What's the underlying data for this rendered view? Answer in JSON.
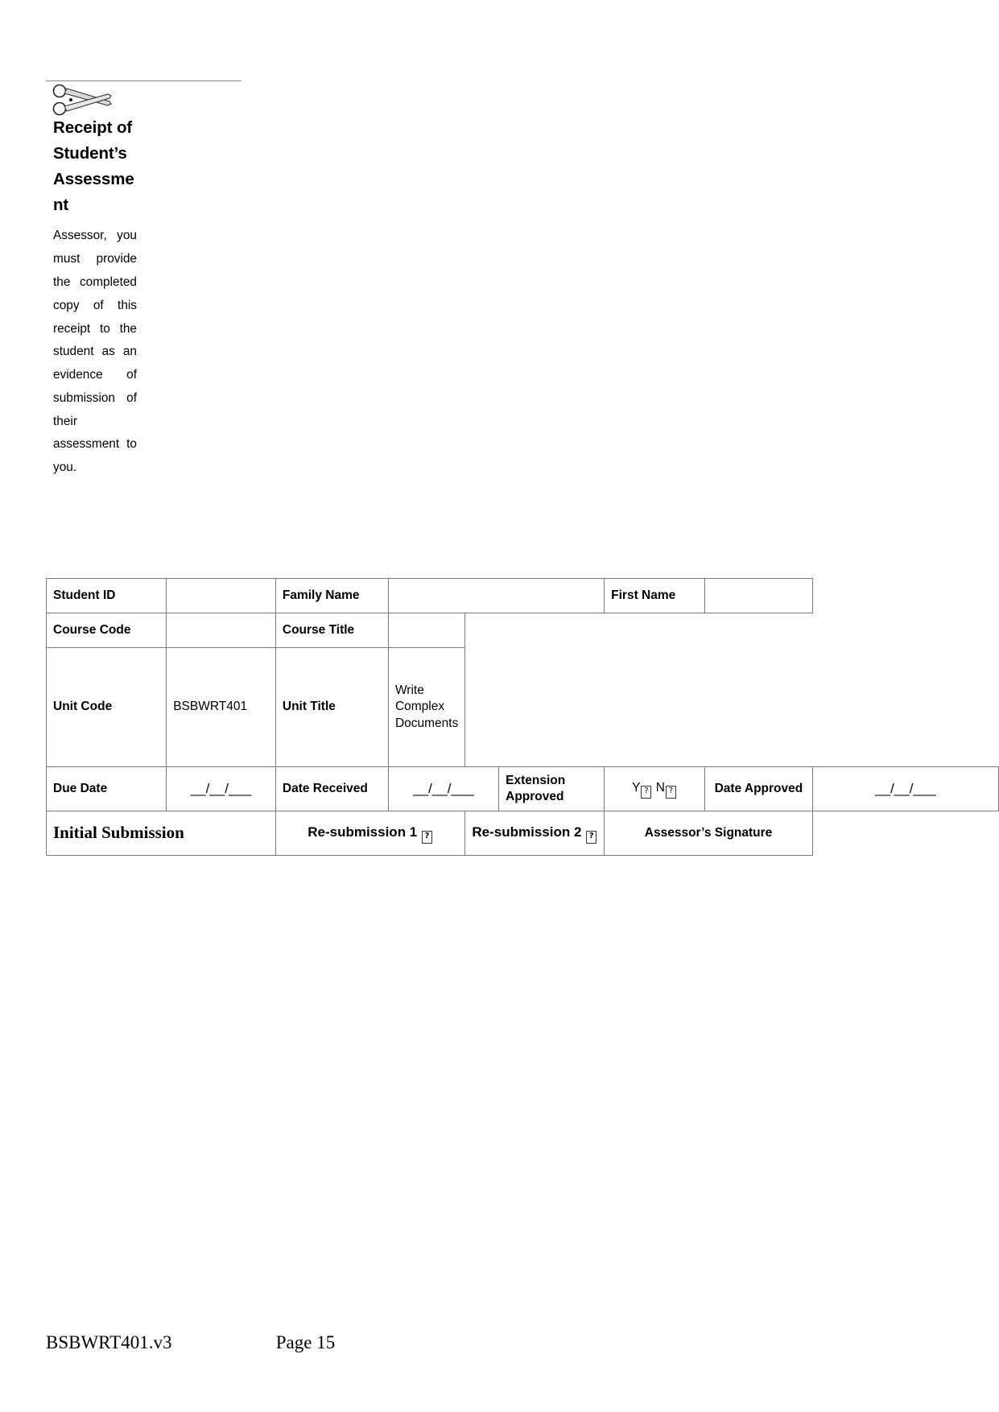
{
  "document": {
    "cut_marker_icon": "scissors-icon",
    "heading": "Receipt of Student’s Assessment",
    "note": "Assessor, you must provide the completed copy of this receipt to the student as an evidence of submission of their assessment to you."
  },
  "table": {
    "rows": {
      "student_id": {
        "label": "Student ID",
        "value": ""
      },
      "family_name": {
        "label": "Family Name",
        "value": ""
      },
      "first_name": {
        "label": "First Name",
        "value": ""
      },
      "course_code": {
        "label": "Course Code",
        "value": ""
      },
      "course_title": {
        "label": "Course Title",
        "value": ""
      },
      "unit_code": {
        "label": "Unit Code",
        "value": "BSBWRT401"
      },
      "unit_title": {
        "label": "Unit Title",
        "value": "Write Complex Documents"
      },
      "due_date": {
        "label": "Due Date",
        "value": "__/__/___"
      },
      "date_received": {
        "label": "Date Received",
        "value": "__/__/___"
      },
      "extension_approved": {
        "label": "Extension Approved",
        "yes": "Y",
        "no": "N",
        "checkbox": "☐"
      },
      "date_approved": {
        "label": "Date Approved",
        "value": "__/__/___"
      }
    },
    "submission": {
      "initial": "Initial Submission",
      "resubmission_1": "Re-submission 1",
      "resubmission_2": "Re-submission 2",
      "checkbox": "☐",
      "assessor_signature": "Assessor’s Signature"
    }
  },
  "footer": {
    "doc_id": "BSBWRT401.v3",
    "page": "Page 15"
  }
}
